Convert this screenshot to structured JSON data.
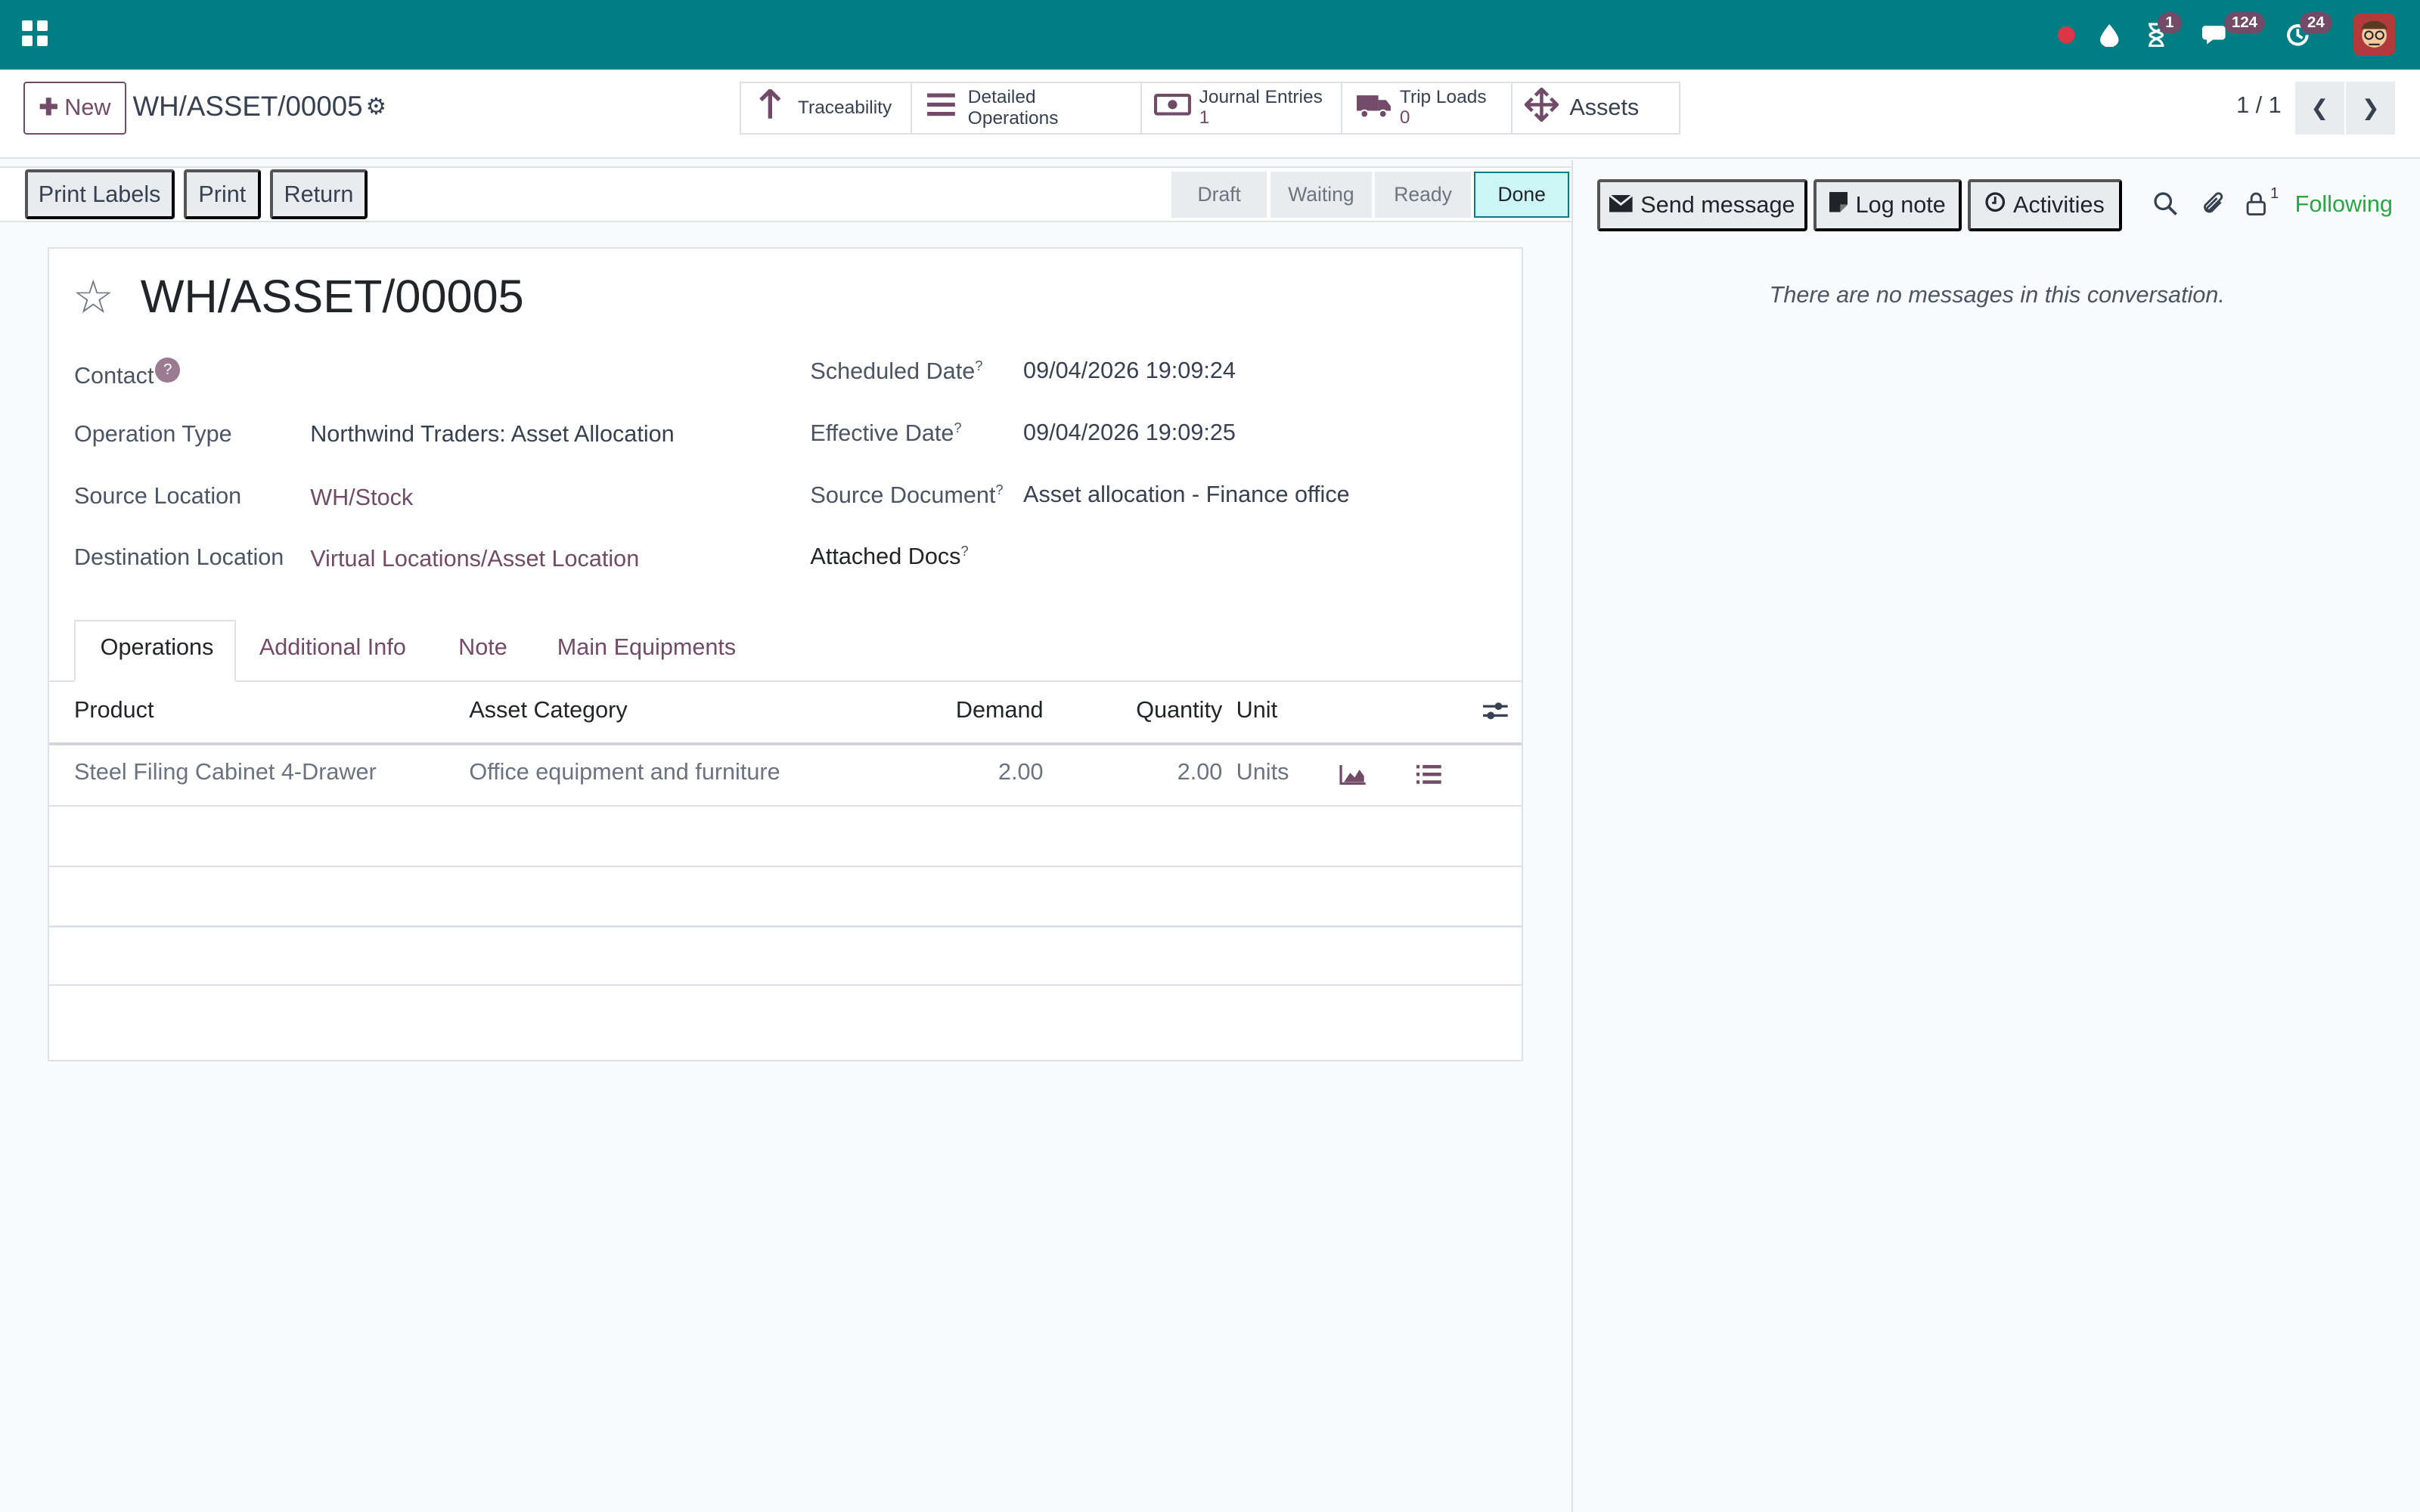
{
  "navbar": {
    "badges": {
      "activities": "1",
      "messages": "124",
      "updates": "24"
    }
  },
  "control_panel": {
    "new_label": "New",
    "record_name": "WH/ASSET/00005",
    "smart_buttons": [
      {
        "label": "Traceability"
      },
      {
        "label": "Detailed Operations"
      },
      {
        "label": "Journal Entries",
        "count": "1"
      },
      {
        "label": "Trip Loads",
        "count": "0"
      },
      {
        "label": "Assets"
      }
    ],
    "pager": "1 / 1"
  },
  "actions": {
    "print_labels": "Print Labels",
    "print": "Print",
    "return": "Return"
  },
  "stages": [
    "Draft",
    "Waiting",
    "Ready",
    "Done"
  ],
  "form": {
    "title": "WH/ASSET/00005",
    "contact_label": "Contact",
    "help_mark": "?",
    "operation_type_label": "Operation Type",
    "operation_type": "Northwind Traders: Asset Allocation",
    "source_location_label": "Source Location",
    "source_location": "WH/Stock",
    "destination_location_label": "Destination Location",
    "destination_location": "Virtual Locations/Asset Location",
    "scheduled_date_label": "Scheduled Date",
    "scheduled_date": "09/04/2026 19:09:24",
    "effective_date_label": "Effective Date",
    "effective_date": "09/04/2026 19:09:25",
    "source_document_label": "Source Document",
    "source_document": "Asset allocation - Finance office",
    "attached_docs_label": "Attached Docs"
  },
  "tabs": [
    "Operations",
    "Additional Info",
    "Note",
    "Main Equipments"
  ],
  "table": {
    "headers": {
      "product": "Product",
      "category": "Asset Category",
      "demand": "Demand",
      "quantity": "Quantity",
      "unit": "Unit"
    },
    "rows": [
      {
        "product": "Steel Filing Cabinet 4-Drawer",
        "category": "Office equipment and furniture",
        "demand": "2.00",
        "quantity": "2.00",
        "unit": "Units"
      }
    ]
  },
  "chatter": {
    "send_message": "Send message",
    "log_note": "Log note",
    "activities": "Activities",
    "followers_count": "1",
    "following": "Following",
    "empty": "There are no messages in this conversation."
  },
  "colors": {
    "navbar": "#017e84",
    "brand": "#714b67",
    "following": "#28a745"
  }
}
